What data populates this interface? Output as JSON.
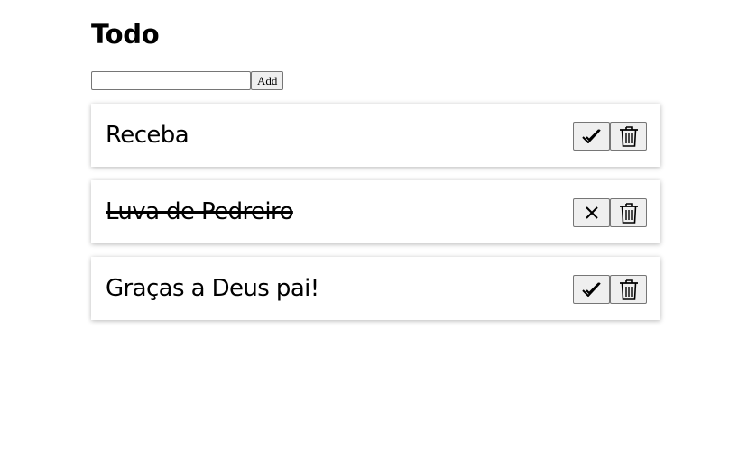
{
  "header": {
    "title": "Todo"
  },
  "form": {
    "input_value": "",
    "placeholder": "",
    "add_label": "Add"
  },
  "todos": [
    {
      "text": "Receba",
      "completed": false,
      "toggle_icon": "check-icon",
      "delete_icon": "trash-icon"
    },
    {
      "text": "Luva de Pedreiro",
      "completed": true,
      "toggle_icon": "close-icon",
      "delete_icon": "trash-icon"
    },
    {
      "text": "Graças a Deus pai!",
      "completed": false,
      "toggle_icon": "check-icon",
      "delete_icon": "trash-icon"
    }
  ]
}
